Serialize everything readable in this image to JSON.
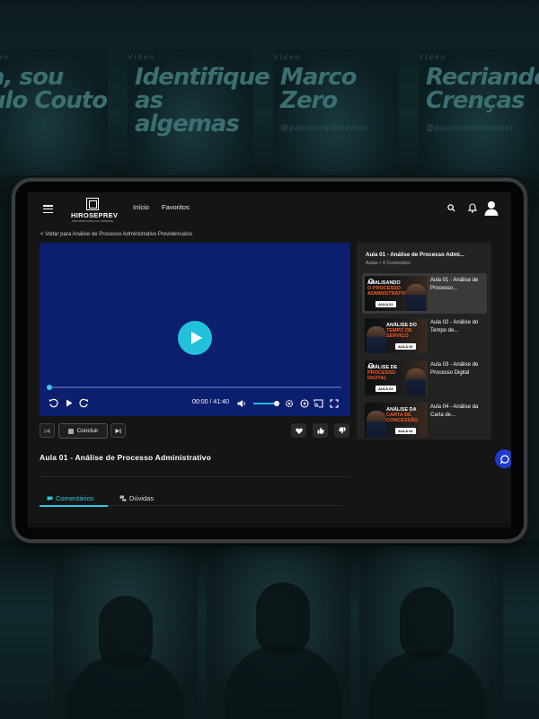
{
  "background": {
    "posters": [
      {
        "subtitle": "Vídeo",
        "title_line1": "a, sou",
        "title_line2": "ulo Couto",
        "handle": ""
      },
      {
        "subtitle": "Vídeo",
        "title_line1": "Identifique",
        "title_line2": "as algemas",
        "handle": ""
      },
      {
        "subtitle": "Vídeo",
        "title_line1": "Marco",
        "title_line2": "Zero",
        "handle": "@paulocoutomentor"
      },
      {
        "subtitle": "Vídeo",
        "title_line1": "Recriando",
        "title_line2": "Crenças",
        "handle": "@paulocoutomentor"
      }
    ]
  },
  "header": {
    "logo_name": "HIROSEPREV",
    "logo_tag": "PREVIDENCIÁRIO DE VERDADE",
    "nav": [
      "Início",
      "Favoritos"
    ],
    "icons": [
      "menu-icon",
      "search-icon",
      "bell-icon",
      "user-icon"
    ]
  },
  "back_link": "< Voltar para Análise de Processo Administrativo Previdenciário",
  "player": {
    "time": "00:00 / 41:40",
    "progress": 0.0,
    "volume": 0.85,
    "accent": "#23c2dc",
    "background": "#0c1e6e"
  },
  "actions": {
    "complete_label": "Concluir"
  },
  "lesson_title": "Aula 01 - Análise de Processo Administrativo",
  "tabs": [
    {
      "label": "Comentários",
      "active": true
    },
    {
      "label": "Dúvidas",
      "active": false
    }
  ],
  "sidebar": {
    "title": "Aula 01 - Análise de Processo Admi...",
    "subtitle": "Aulas • 4 Conteúdos",
    "items": [
      {
        "label": "Aula 01 - Análise de Processo...",
        "thumb_line1": "ANALISANDO",
        "thumb_line2": "O PROCESSO",
        "thumb_line3": "ADMINISTRATIVO",
        "badge": "AULA 01",
        "active": true
      },
      {
        "label": "Aula 02 - Análise do Tempo de...",
        "thumb_line1": "ANÁLISE DO",
        "thumb_line2": "TEMPO DE",
        "thumb_line3": "SERVIÇO",
        "badge": "AULA 02",
        "active": false
      },
      {
        "label": "Aula 03 - Análise de Processo Digital",
        "thumb_line1": "ANÁLISE DE",
        "thumb_line2": "PROCESSO",
        "thumb_line3": "DIGITAL",
        "badge": "AULA 03",
        "active": false
      },
      {
        "label": "Aula 04 - Análise da Carta de...",
        "thumb_line1": "ANÁLISE DA",
        "thumb_line2": "CARTA DE",
        "thumb_line3": "CONCESSÃO",
        "badge": "AULA 04",
        "active": false
      }
    ]
  }
}
